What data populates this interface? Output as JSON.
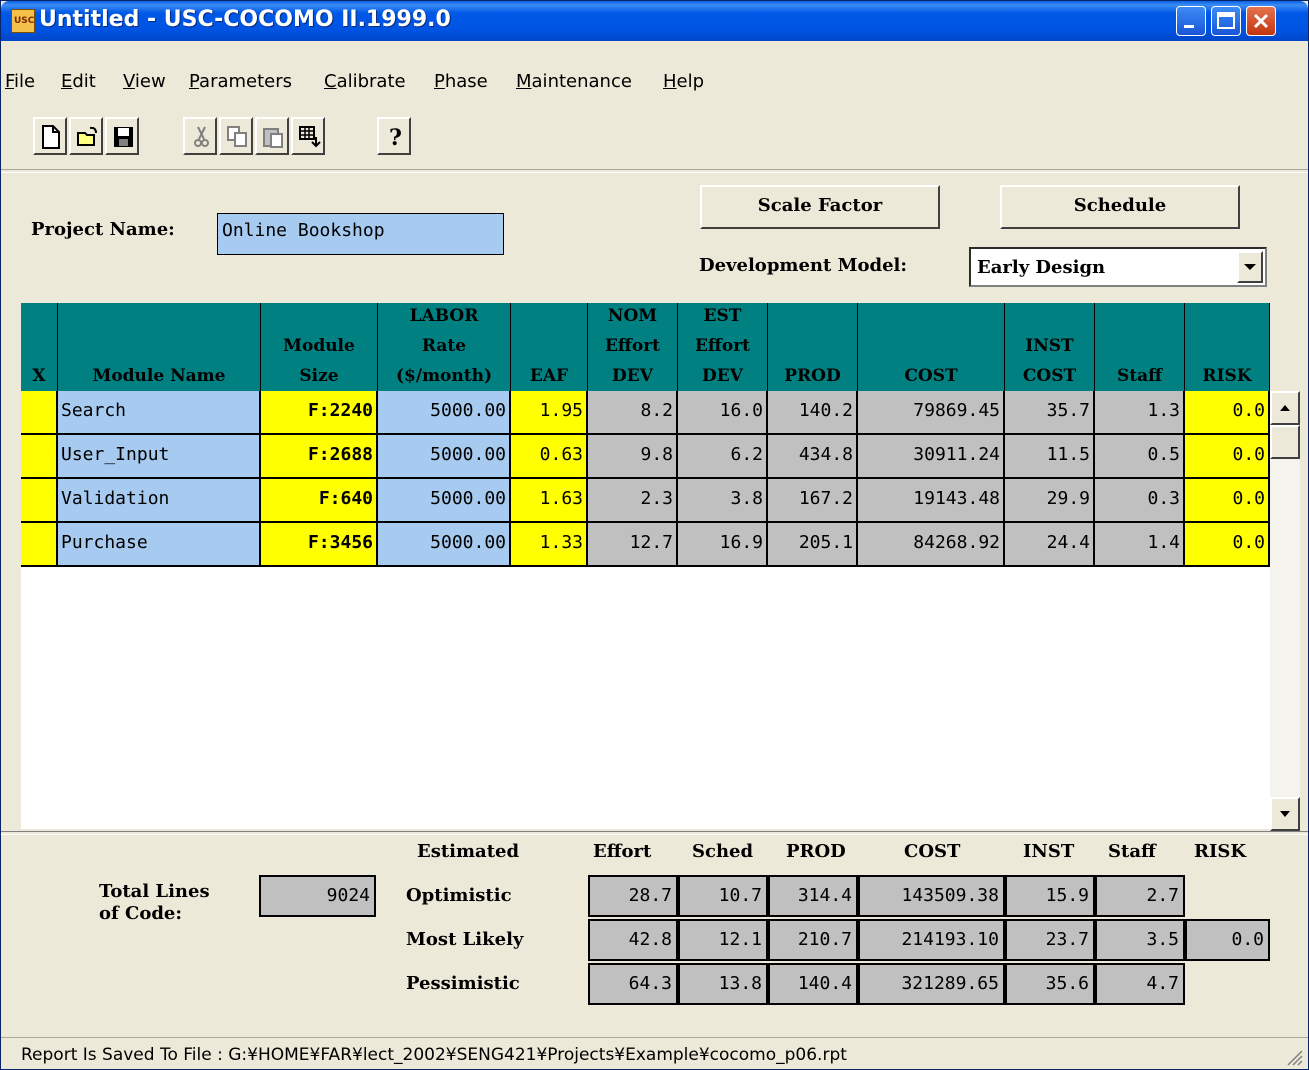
{
  "window": {
    "title": "Untitled - USC-COCOMO II.1999.0",
    "icon_label": "USC"
  },
  "menu": [
    "File",
    "Edit",
    "View",
    "Parameters",
    "Calibrate",
    "Phase",
    "Maintenance",
    "Help"
  ],
  "toolbar": [
    "new-icon",
    "open-icon",
    "save-icon",
    "cut-icon",
    "copy-icon",
    "paste-icon",
    "add-module-icon",
    "help-icon"
  ],
  "project": {
    "label": "Project Name:",
    "value": "Online Bookshop"
  },
  "buttons": {
    "scale_factor": "Scale Factor",
    "schedule": "Schedule"
  },
  "dev_model": {
    "label": "Development Model:",
    "value": "Early Design"
  },
  "grid": {
    "headers": [
      {
        "lines": [
          "X"
        ]
      },
      {
        "lines": [
          "Module Name"
        ]
      },
      {
        "lines": [
          "Module",
          "Size"
        ]
      },
      {
        "lines": [
          "LABOR",
          "Rate",
          "($/month)"
        ]
      },
      {
        "lines": [
          "EAF"
        ]
      },
      {
        "lines": [
          "NOM",
          "Effort",
          "DEV"
        ]
      },
      {
        "lines": [
          "EST",
          "Effort",
          "DEV"
        ]
      },
      {
        "lines": [
          "PROD"
        ]
      },
      {
        "lines": [
          "COST"
        ]
      },
      {
        "lines": [
          "INST",
          "COST"
        ]
      },
      {
        "lines": [
          "Staff"
        ]
      },
      {
        "lines": [
          "RISK"
        ]
      }
    ],
    "rows": [
      {
        "x": "",
        "name": "Search",
        "size": "F:2240",
        "rate": "5000.00",
        "eaf": "1.95",
        "nom": "8.2",
        "est": "16.0",
        "prod": "140.2",
        "cost": "79869.45",
        "inst": "35.7",
        "staff": "1.3",
        "risk": "0.0"
      },
      {
        "x": "",
        "name": "User_Input",
        "size": "F:2688",
        "rate": "5000.00",
        "eaf": "0.63",
        "nom": "9.8",
        "est": "6.2",
        "prod": "434.8",
        "cost": "30911.24",
        "inst": "11.5",
        "staff": "0.5",
        "risk": "0.0"
      },
      {
        "x": "",
        "name": "Validation",
        "size": "F:640",
        "rate": "5000.00",
        "eaf": "1.63",
        "nom": "2.3",
        "est": "3.8",
        "prod": "167.2",
        "cost": "19143.48",
        "inst": "29.9",
        "staff": "0.3",
        "risk": "0.0"
      },
      {
        "x": "",
        "name": "Purchase",
        "size": "F:3456",
        "rate": "5000.00",
        "eaf": "1.33",
        "nom": "12.7",
        "est": "16.9",
        "prod": "205.1",
        "cost": "84268.92",
        "inst": "24.4",
        "staff": "1.4",
        "risk": "0.0"
      }
    ]
  },
  "totals": {
    "label_line1": "Total Lines",
    "label_line2": "of Code:",
    "value": "9024",
    "headers": [
      "Estimated",
      "Effort",
      "Sched",
      "PROD",
      "COST",
      "INST",
      "Staff",
      "RISK"
    ],
    "rows": [
      {
        "label": "Optimistic",
        "effort": "28.7",
        "sched": "10.7",
        "prod": "314.4",
        "cost": "143509.38",
        "inst": "15.9",
        "staff": "2.7"
      },
      {
        "label": "Most Likely",
        "effort": "42.8",
        "sched": "12.1",
        "prod": "210.7",
        "cost": "214193.10",
        "inst": "23.7",
        "staff": "3.5",
        "risk": "0.0"
      },
      {
        "label": "Pessimistic",
        "effort": "64.3",
        "sched": "13.8",
        "prod": "140.4",
        "cost": "321289.65",
        "inst": "35.6",
        "staff": "4.7"
      }
    ]
  },
  "status": "Report Is Saved To File : G:¥HOME¥FAR¥lect_2002¥SENG421¥Projects¥Example¥cocomo_p06.rpt"
}
